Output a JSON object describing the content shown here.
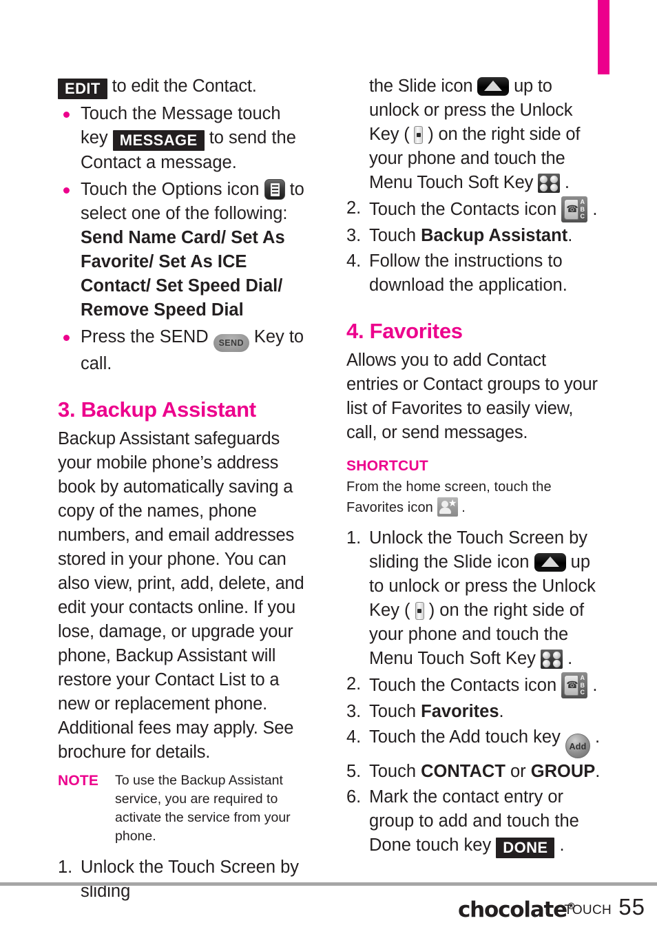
{
  "page": {
    "number": "55",
    "brand": "chocolate",
    "brand_registered": "®",
    "brand_sub": "TOUCH",
    "accent_color": "#ec008c",
    "text_color": "#231f20"
  },
  "left_column": {
    "continued_line": {
      "chip": "EDIT",
      "after": " to edit the Contact."
    },
    "bullets": [
      {
        "before": "Touch the Message touch key ",
        "chip": "MESSAGE",
        "after": " to send the Contact a message."
      },
      {
        "before": "Touch the Options icon ",
        "icon": "options-icon",
        "after": " to select one of the following:",
        "bold_follow": "Send Name Card/ Set As Favorite/ Set As ICE Contact/ Set Speed Dial/ Remove Speed Dial"
      },
      {
        "before": "Press the SEND ",
        "icon": "send-key-icon",
        "icon_label": "SEND",
        "after": " Key to call."
      }
    ],
    "section": {
      "heading": "3. Backup Assistant",
      "paragraph": "Backup Assistant safeguards your mobile phone’s address book by automatically saving a copy of the names, phone numbers, and email addresses stored in your phone. You can also view, print, add, delete, and edit your contacts online. If you lose, damage, or upgrade your phone, Backup Assistant will restore your Contact List to a new or replacement phone. Additional fees may apply. See brochure for details.",
      "note": {
        "label": "NOTE",
        "text": "To use the Backup Assistant service, you are required to activate the service from your phone."
      },
      "step1_start": {
        "num": "1.",
        "text": "Unlock the Touch Screen by sliding"
      }
    }
  },
  "right_column": {
    "continued_step": {
      "p1": "the Slide icon ",
      "p2": " up to unlock or press the Unlock Key ( ",
      "p3": " ) on the right side of your phone and touch the Menu Touch Soft Key ",
      "p4": " ."
    },
    "steps": [
      {
        "num": "2.",
        "before": "Touch the Contacts icon ",
        "icon": "contacts-icon",
        "after": " ."
      },
      {
        "num": "3.",
        "before": "Touch ",
        "bold": "Backup Assistant",
        "after": "."
      },
      {
        "num": "4.",
        "before": "Follow the instructions to download the application.",
        "after": ""
      }
    ],
    "section": {
      "heading": "4. Favorites",
      "paragraph": "Allows you to add Contact entries or Contact groups to your list of Favorites to easily view, call, or send messages.",
      "shortcut": {
        "label": "SHORTCUT",
        "text_before": "From the home screen, touch the Favorites icon ",
        "icon": "favorites-icon",
        "text_after": " ."
      },
      "steps": [
        {
          "num": "1.",
          "t1": "Unlock the Touch Screen by sliding the Slide icon ",
          "t2": " up to unlock or press the Unlock Key ( ",
          "t3": " ) on the right side of your phone and touch the Menu Touch Soft Key ",
          "t4": " ."
        },
        {
          "num": "2.",
          "before": "Touch the Contacts icon ",
          "after": " ."
        },
        {
          "num": "3.",
          "before": "Touch ",
          "bold": "Favorites",
          "after": "."
        },
        {
          "num": "4.",
          "before": "Touch the Add touch key ",
          "icon_label": "Add",
          "after": " ."
        },
        {
          "num": "5.",
          "before": "Touch ",
          "bold1": "CONTACT",
          "mid": " or ",
          "bold2": "GROUP",
          "after": "."
        },
        {
          "num": "6.",
          "before": "Mark the contact entry or group to add and touch the Done touch key ",
          "chip": "DONE",
          "after": " ."
        }
      ]
    }
  }
}
